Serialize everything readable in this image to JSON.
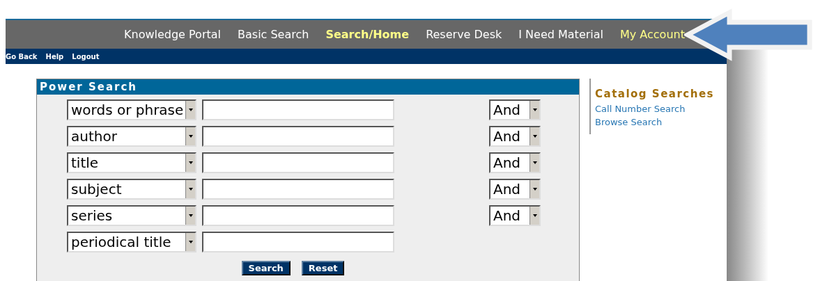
{
  "top_nav": [
    {
      "label": "Knowledge Portal",
      "selected": false,
      "color": "#ffffff"
    },
    {
      "label": "Basic Search",
      "selected": false,
      "color": "#ffffff"
    },
    {
      "label": "Search/Home",
      "selected": true,
      "color": "#ffff88"
    },
    {
      "label": "Reserve Desk",
      "selected": false,
      "color": "#ffffff"
    },
    {
      "label": "I Need Material",
      "selected": false,
      "color": "#ffffff"
    },
    {
      "label": "My Account",
      "selected": false,
      "color": "#ffff88"
    }
  ],
  "sub_nav": [
    "Go Back",
    "Help",
    "Logout"
  ],
  "power_search": {
    "title": "Power Search",
    "rows": [
      {
        "field": "words or phrase",
        "connector": "And"
      },
      {
        "field": "author",
        "connector": "And"
      },
      {
        "field": "title",
        "connector": "And"
      },
      {
        "field": "subject",
        "connector": "And"
      },
      {
        "field": "series",
        "connector": "And"
      },
      {
        "field": "periodical title"
      }
    ],
    "buttons": [
      "Search",
      "Reset"
    ]
  },
  "sidebar": {
    "title": "Catalog Searches",
    "links": [
      "Call Number Search",
      "Browse Search"
    ]
  }
}
